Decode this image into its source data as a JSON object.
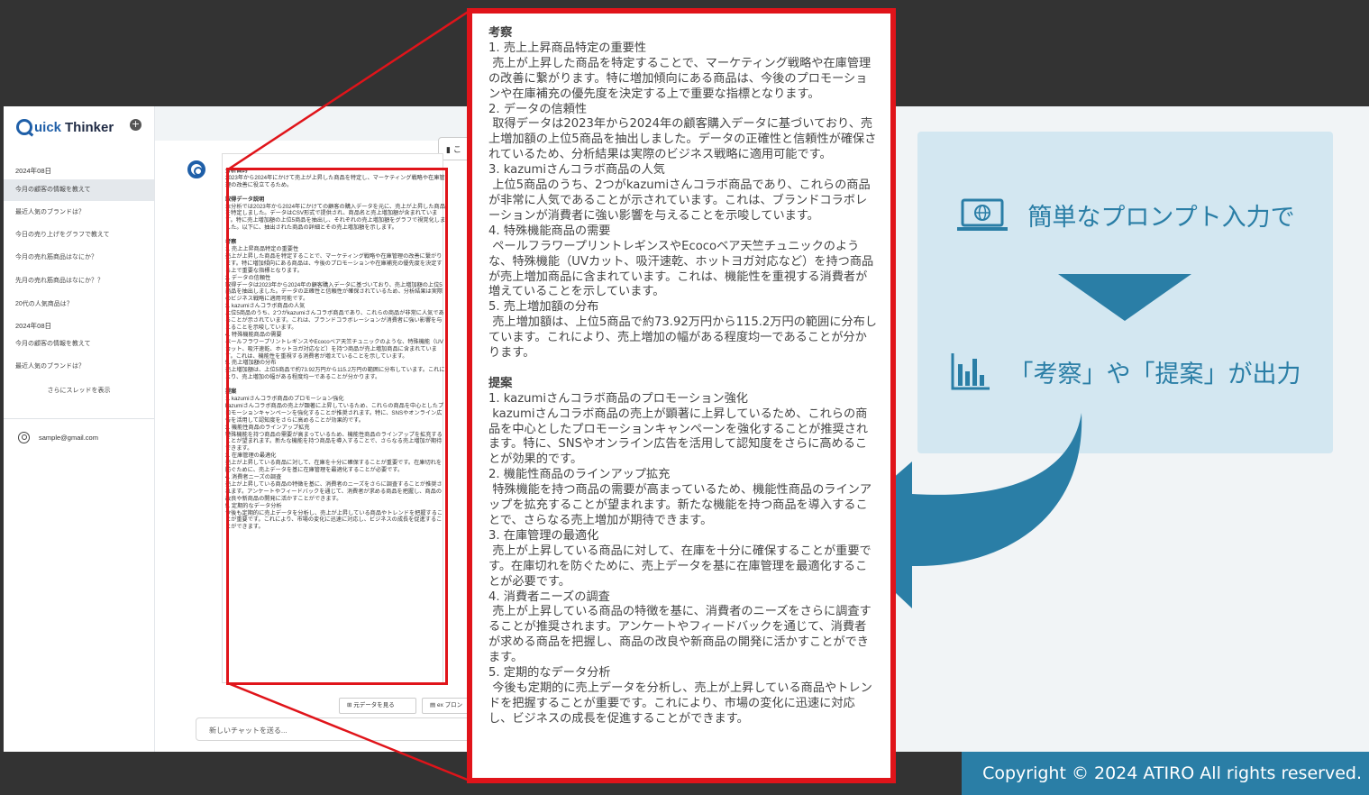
{
  "sidebar": {
    "logo_q": "Q",
    "logo_uick": "uick",
    "logo_thinker": "Thinker",
    "new_label": "+",
    "groups": [
      {
        "date": "2024年08日",
        "items": [
          "今月の顧客の情報を教えて",
          "最近人気のブランドは？",
          "今日の売り上げをグラフで教えて",
          "今月の売れ筋商品はなにか？",
          "先月の売れ筋商品はなにか？？",
          "20代の人気商品は？"
        ]
      },
      {
        "date": "2024年08日",
        "items": [
          "今月の顧客の情報を教えて",
          "最近人気のブランドは？"
        ]
      }
    ],
    "show_more": "さらにスレッドを表示",
    "user_email": "sample@gmail.com"
  },
  "chat": {
    "copy_label": "こ",
    "source_button": "元データを見る",
    "prompt_button": "ex プロン",
    "input_placeholder": "新しいチャットを送る...",
    "answer_small": [
      {
        "h": "分析目的"
      },
      {
        "t": "2023年から2024年にかけて売上が上昇した商品を特定し、マーケティング戦略や在庫管理の改善に役立てるため。"
      },
      {
        "t": ""
      },
      {
        "h": "取得データ説明"
      },
      {
        "t": "本分析では2023年から2024年にかけての顧客の購入データを元に、売上が上昇した商品を特定しました。データはCSV形式で提供され、商品名と売上増加額が含まれています。特に売上増加額の上位5商品を抽出し、それぞれの売上増加額をグラフで視覚化しました。以下に、抽出された商品の詳細とその売上増加額を示します。"
      },
      {
        "t": ""
      },
      {
        "h": "考察"
      },
      {
        "t": "1. 売上上昇商品特定の重要性\n売上が上昇した商品を特定することで、マーケティング戦略や在庫管理の改善に繋がります。特に増加傾向にある商品は、今後のプロモーションや在庫補充の優先度を決定する上で重要な指標となります。\n2. データの信頼性\n取得データは2023年から2024年の顧客購入データに基づいており、売上増加額の上位5商品を抽出しました。データの正確性と信頼性が確保されているため、分析結果は実際のビジネス戦略に適用可能です。\n3. kazumiさんコラボ商品の人気\n上位5商品のうち、2つがkazumiさんコラボ商品であり、これらの商品が非常に人気であることが示されています。これは、ブランドコラボレーションが消費者に強い影響を与えることを示唆しています。\n4. 特殊機能商品の需要\nペールフラワープリントレギンスやEcocoベア天竺チュニックのような、特殊機能（UVカット、吸汗速乾、ホットヨガ対応など）を持つ商品が売上増加商品に含まれています。これは、機能性を重視する消費者が増えていることを示しています。\n5. 売上増加額の分布\n売上増加額は、上位5商品で約73.92万円から115.2万円の範囲に分布しています。これにより、売上増加の幅がある程度均一であることが分かります。"
      },
      {
        "t": ""
      },
      {
        "h": "提案"
      },
      {
        "t": "1. kazumiさんコラボ商品のプロモーション強化\nkazumiさんコラボ商品の売上が顕著に上昇しているため、これらの商品を中心としたプロモーションキャンペーンを強化することが推奨されます。特に、SNSやオンライン広告を活用して認知度をさらに高めることが効果的です。\n2. 機能性商品のラインアップ拡充\n特殊機能を持つ商品の需要が高まっているため、機能性商品のラインアップを拡充することが望まれます。新たな機能を持つ商品を導入することで、さらなる売上増加が期待できます。\n3. 在庫管理の最適化\n売上が上昇している商品に対して、在庫を十分に確保することが重要です。在庫切れを防ぐために、売上データを基に在庫管理を最適化することが必要です。\n4. 消費者ニーズの調査\n売上が上昇している商品の特徴を基に、消費者のニーズをさらに調査することが推奨されます。アンケートやフィードバックを通じて、消費者が求める商品を把握し、商品の改良や新商品の開発に活かすことができます。\n5. 定期的なデータ分析\n今後も定期的に売上データを分析し、売上が上昇している商品やトレンドを把握することが重要です。これにより、市場の変化に迅速に対応し、ビジネスの成長を促進することができます。"
      }
    ]
  },
  "zoom": {
    "blocks": [
      {
        "h": "考察"
      },
      {
        "t": "1. 売上上昇商品特定の重要性\n 売上が上昇した商品を特定することで、マーケティング戦略や在庫管理の改善に繋がります。特に増加傾向にある商品は、今後のプロモーションや在庫補充の優先度を決定する上で重要な指標となります。\n2. データの信頼性\n 取得データは2023年から2024年の顧客購入データに基づいており、売上増加額の上位5商品を抽出しました。データの正確性と信頼性が確保されているため、分析結果は実際のビジネス戦略に適用可能です。\n3. kazumiさんコラボ商品の人気\n 上位5商品のうち、2つがkazumiさんコラボ商品であり、これらの商品が非常に人気であることが示されています。これは、ブランドコラボレーションが消費者に強い影響を与えることを示唆しています。\n4. 特殊機能商品の需要\n ペールフラワープリントレギンスやEcocoベア天竺チュニックのような、特殊機能（UVカット、吸汗速乾、ホットヨガ対応など）を持つ商品が売上増加商品に含まれています。これは、機能性を重視する消費者が増えていることを示しています。\n5. 売上増加額の分布\n 売上増加額は、上位5商品で約73.92万円から115.2万円の範囲に分布しています。これにより、売上増加の幅がある程度均一であることが分かります。"
      },
      {
        "t": ""
      },
      {
        "h": "提案"
      },
      {
        "t": "1. kazumiさんコラボ商品のプロモーション強化\n kazumiさんコラボ商品の売上が顕著に上昇しているため、これらの商品を中心としたプロモーションキャンペーンを強化することが推奨されます。特に、SNSやオンライン広告を活用して認知度をさらに高めることが効果的です。\n2. 機能性商品のラインアップ拡充\n 特殊機能を持つ商品の需要が高まっているため、機能性商品のラインアップを拡充することが望まれます。新たな機能を持つ商品を導入することで、さらなる売上増加が期待できます。\n3. 在庫管理の最適化\n 売上が上昇している商品に対して、在庫を十分に確保することが重要です。在庫切れを防ぐために、売上データを基に在庫管理を最適化することが必要です。\n4. 消費者ニーズの調査\n 売上が上昇している商品の特徴を基に、消費者のニーズをさらに調査することが推奨されます。アンケートやフィードバックを通じて、消費者が求める商品を把握し、商品の改良や新商品の開発に活かすことができます。\n5. 定期的なデータ分析\n 今後も定期的に売上データを分析し、売上が上昇している商品やトレンドを把握することが重要です。これにより、市場の変化に迅速に対応し、ビジネスの成長を促進することができます。"
      }
    ]
  },
  "info": {
    "line1": "簡単なプロンプト入力で",
    "line2": "「考察」や「提案」が出力",
    "icon1": "laptop-globe-icon",
    "icon2": "bar-chart-icon"
  },
  "copyright": "Copyright © 2024 ATIRO  All rights reserved.",
  "colors": {
    "accent": "#2a7ea6",
    "highlight": "#e0141a",
    "info_bg": "#d3e7f1",
    "brand": "#1f5fa8"
  }
}
